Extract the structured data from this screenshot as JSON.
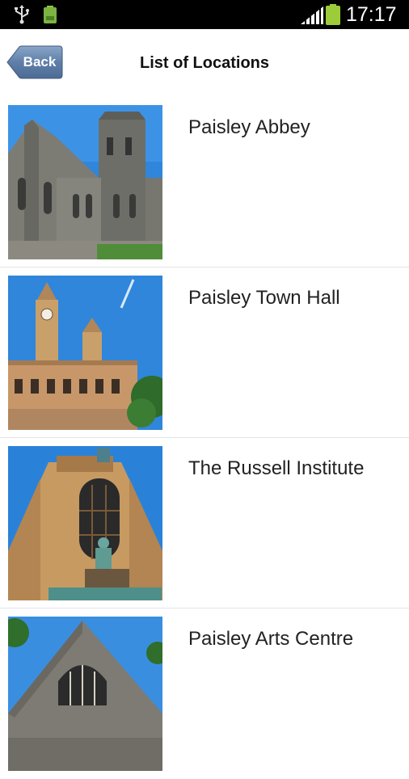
{
  "status_bar": {
    "time": "17:17",
    "icons": [
      "usb-icon",
      "battery-notification-icon",
      "signal-icon",
      "battery-icon"
    ]
  },
  "header": {
    "back_label": "Back",
    "title": "List of Locations"
  },
  "locations": [
    {
      "name": "Paisley Abbey",
      "image": "paisley-abbey-photo"
    },
    {
      "name": "Paisley Town Hall",
      "image": "paisley-town-hall-photo"
    },
    {
      "name": "The Russell Institute",
      "image": "russell-institute-photo"
    },
    {
      "name": "Paisley Arts Centre",
      "image": "paisley-arts-centre-photo"
    }
  ],
  "colors": {
    "status_bar_bg": "#000000",
    "back_button": "#5b7ba3",
    "sky": "#2f7fd6",
    "stone": "#7a7a74",
    "sandstone": "#c79a62"
  }
}
